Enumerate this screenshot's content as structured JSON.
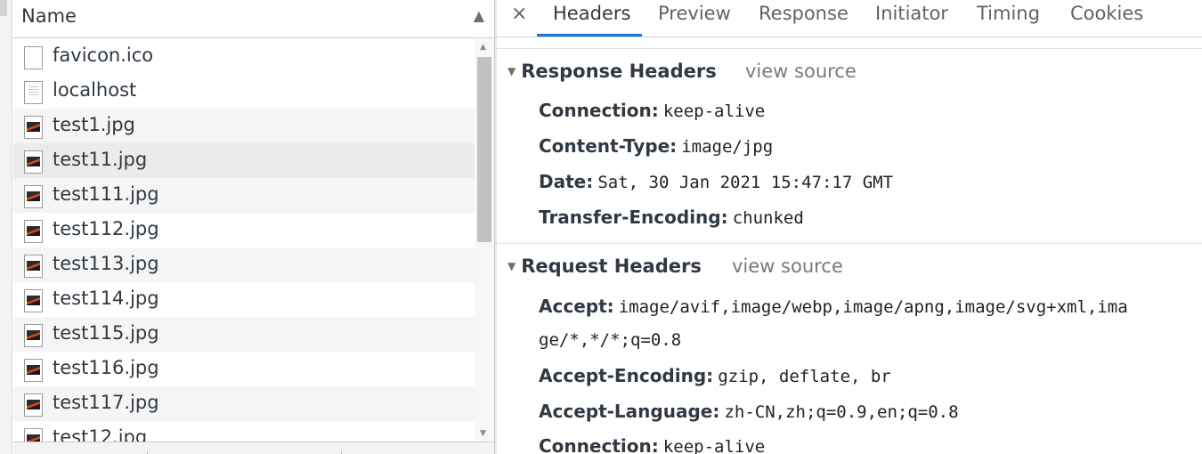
{
  "request_list": {
    "header": "Name",
    "sort_icon": "sort-ascending-icon",
    "items": [
      {
        "name": "favicon.ico",
        "icon": "blank-file-icon"
      },
      {
        "name": "localhost",
        "icon": "document-file-icon"
      },
      {
        "name": "test1.jpg",
        "icon": "image-file-icon"
      },
      {
        "name": "test11.jpg",
        "icon": "image-file-icon"
      },
      {
        "name": "test111.jpg",
        "icon": "image-file-icon"
      },
      {
        "name": "test112.jpg",
        "icon": "image-file-icon"
      },
      {
        "name": "test113.jpg",
        "icon": "image-file-icon"
      },
      {
        "name": "test114.jpg",
        "icon": "image-file-icon"
      },
      {
        "name": "test115.jpg",
        "icon": "image-file-icon"
      },
      {
        "name": "test116.jpg",
        "icon": "image-file-icon"
      },
      {
        "name": "test117.jpg",
        "icon": "image-file-icon"
      },
      {
        "name": "test12.jpg",
        "icon": "image-file-icon"
      }
    ],
    "selected_item": "test11.jpg"
  },
  "details": {
    "close_label": "×",
    "tabs": [
      "Headers",
      "Preview",
      "Response",
      "Initiator",
      "Timing",
      "Cookies"
    ],
    "active_tab": "Headers",
    "accent_color": "#1a73e8",
    "response_headers": {
      "title": "Response Headers",
      "view_source": "view source",
      "rows": [
        {
          "key": "Connection:",
          "value": "keep-alive"
        },
        {
          "key": "Content-Type:",
          "value": "image/jpg"
        },
        {
          "key": "Date:",
          "value": "Sat, 30 Jan 2021 15:47:17 GMT"
        },
        {
          "key": "Transfer-Encoding:",
          "value": "chunked"
        }
      ]
    },
    "request_headers": {
      "title": "Request Headers",
      "view_source": "view source",
      "rows": [
        {
          "key": "Accept:",
          "value": "image/avif,image/webp,image/apng,image/svg+xml,ima",
          "continuation": "ge/*,*/*;q=0.8"
        },
        {
          "key": "Accept-Encoding:",
          "value": "gzip, deflate, br"
        },
        {
          "key": "Accept-Language:",
          "value": "zh-CN,zh;q=0.9,en;q=0.8"
        },
        {
          "key": "Connection:",
          "value": "keep-alive"
        }
      ]
    }
  }
}
